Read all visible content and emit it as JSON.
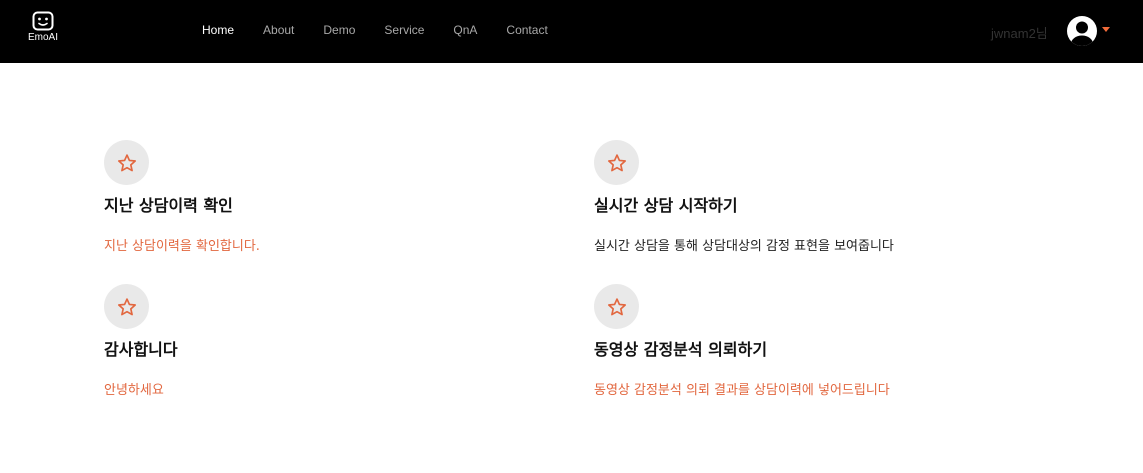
{
  "brand": {
    "name": "EmoAI",
    "icon": "smiley-face-icon"
  },
  "nav": {
    "items": [
      {
        "label": "Home",
        "active": true
      },
      {
        "label": "About",
        "active": false
      },
      {
        "label": "Demo",
        "active": false
      },
      {
        "label": "Service",
        "active": false
      },
      {
        "label": "QnA",
        "active": false
      },
      {
        "label": "Contact",
        "active": false
      }
    ]
  },
  "user": {
    "name": "jwnam2님",
    "avatar_icon": "user-avatar-icon",
    "menu_icon": "caret-down-icon"
  },
  "features": [
    {
      "icon": "star-icon",
      "title": "지난 상담이력 확인",
      "description": "지난 상담이력을 확인합니다."
    },
    {
      "icon": "star-icon",
      "title": "실시간 상담 시작하기",
      "description": "실시간 상담을 통해 상담대상의 감정 표현을 보여줍니다"
    },
    {
      "icon": "star-icon",
      "title": "감사합니다",
      "description": "안녕하세요"
    },
    {
      "icon": "star-icon",
      "title": "동영상 감정분석 의뢰하기",
      "description": "동영상 감정분석 의뢰 결과를 상담이력에 넣어드립니다"
    }
  ],
  "colors": {
    "accent": "#e2673f",
    "navbar_bg": "#000000",
    "icon_circle_bg": "#e9e9e9"
  }
}
